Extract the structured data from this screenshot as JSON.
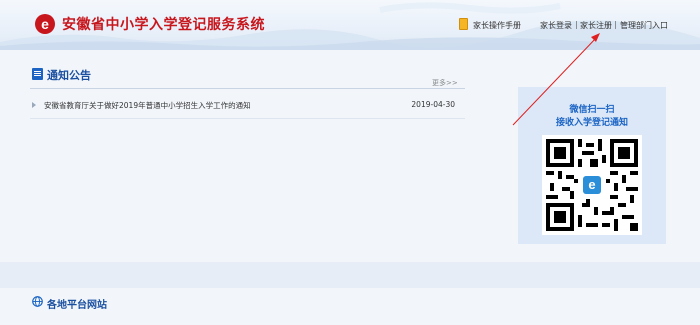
{
  "header": {
    "site_title": "安徽省中小学入学登记服务系统",
    "links": {
      "manual": "家长操作手册",
      "login": "家长登录",
      "register": "家长注册",
      "admin": "管理部门入口"
    },
    "separator": "|"
  },
  "notice": {
    "title": "通知公告",
    "more": "更多>>",
    "items": [
      {
        "text": "安徽省教育厅关于做好2019年普通中小学招生入学工作的通知",
        "date": "2019-04-30"
      }
    ]
  },
  "qr": {
    "title": "微信扫一扫",
    "subtitle": "接收入学登记通知"
  },
  "platform": {
    "title": "各地平台网站"
  },
  "colors": {
    "brand_red": "#c8161d",
    "primary_blue": "#1b64c4",
    "annotation_red": "#e02020"
  }
}
